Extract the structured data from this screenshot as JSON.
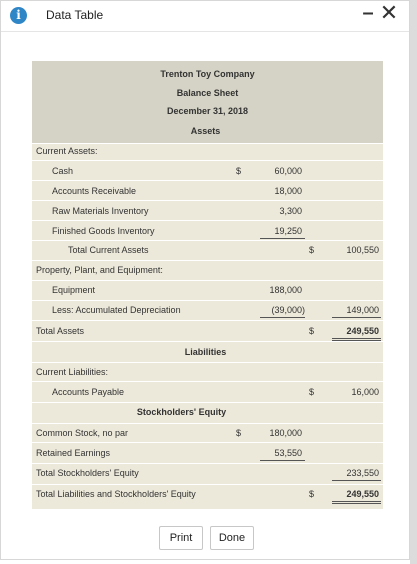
{
  "window": {
    "title": "Data Table",
    "info_icon": "info-icon",
    "minimize_label": "–",
    "close_label": "✕"
  },
  "report": {
    "company": "Trenton Toy Company",
    "statement": "Balance Sheet",
    "date": "December 31, 2018",
    "assets_header": "Assets",
    "current_assets_label": "Current Assets:",
    "cash_label": "Cash",
    "cash_dollar": "$",
    "cash_value": "60,000",
    "ar_label": "Accounts Receivable",
    "ar_value": "18,000",
    "rm_label": "Raw Materials Inventory",
    "rm_value": "3,300",
    "fg_label": "Finished Goods Inventory",
    "fg_value": "19,250",
    "tca_label": "Total Current Assets",
    "tca_dollar": "$",
    "tca_value": "100,550",
    "ppe_label": "Property, Plant, and Equipment:",
    "equip_label": "Equipment",
    "equip_value": "188,000",
    "accdep_label": "Less: Accumulated Depreciation",
    "accdep_value": "(39,000)",
    "netppe_value": "149,000",
    "ta_label": "Total Assets",
    "ta_dollar": "$",
    "ta_value": "249,550",
    "liab_header": "Liabilities",
    "cl_label": "Current Liabilities:",
    "ap_label": "Accounts Payable",
    "ap_dollar": "$",
    "ap_value": "16,000",
    "se_header": "Stockholders' Equity",
    "cs_label": "Common Stock, no par",
    "cs_dollar": "$",
    "cs_value": "180,000",
    "re_label": "Retained Earnings",
    "re_value": "53,550",
    "tse_label": "Total Stockholders' Equity",
    "tse_value": "233,550",
    "tlse_label": "Total Liabilities and Stockholders' Equity",
    "tlse_dollar": "$",
    "tlse_value": "249,550"
  },
  "buttons": {
    "print": "Print",
    "done": "Done"
  }
}
